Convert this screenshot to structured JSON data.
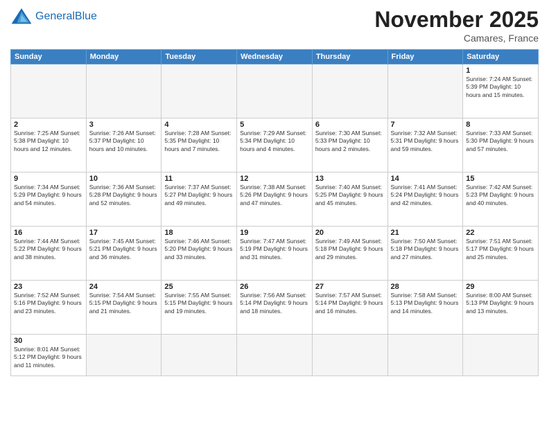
{
  "header": {
    "logo_general": "General",
    "logo_blue": "Blue",
    "month_title": "November 2025",
    "location": "Camares, France"
  },
  "days_of_week": [
    "Sunday",
    "Monday",
    "Tuesday",
    "Wednesday",
    "Thursday",
    "Friday",
    "Saturday"
  ],
  "weeks": [
    [
      {
        "day": null,
        "info": null
      },
      {
        "day": null,
        "info": null
      },
      {
        "day": null,
        "info": null
      },
      {
        "day": null,
        "info": null
      },
      {
        "day": null,
        "info": null
      },
      {
        "day": null,
        "info": null
      },
      {
        "day": "1",
        "info": "Sunrise: 7:24 AM\nSunset: 5:39 PM\nDaylight: 10 hours\nand 15 minutes."
      }
    ],
    [
      {
        "day": "2",
        "info": "Sunrise: 7:25 AM\nSunset: 5:38 PM\nDaylight: 10 hours\nand 12 minutes."
      },
      {
        "day": "3",
        "info": "Sunrise: 7:26 AM\nSunset: 5:37 PM\nDaylight: 10 hours\nand 10 minutes."
      },
      {
        "day": "4",
        "info": "Sunrise: 7:28 AM\nSunset: 5:35 PM\nDaylight: 10 hours\nand 7 minutes."
      },
      {
        "day": "5",
        "info": "Sunrise: 7:29 AM\nSunset: 5:34 PM\nDaylight: 10 hours\nand 4 minutes."
      },
      {
        "day": "6",
        "info": "Sunrise: 7:30 AM\nSunset: 5:33 PM\nDaylight: 10 hours\nand 2 minutes."
      },
      {
        "day": "7",
        "info": "Sunrise: 7:32 AM\nSunset: 5:31 PM\nDaylight: 9 hours\nand 59 minutes."
      },
      {
        "day": "8",
        "info": "Sunrise: 7:33 AM\nSunset: 5:30 PM\nDaylight: 9 hours\nand 57 minutes."
      }
    ],
    [
      {
        "day": "9",
        "info": "Sunrise: 7:34 AM\nSunset: 5:29 PM\nDaylight: 9 hours\nand 54 minutes."
      },
      {
        "day": "10",
        "info": "Sunrise: 7:36 AM\nSunset: 5:28 PM\nDaylight: 9 hours\nand 52 minutes."
      },
      {
        "day": "11",
        "info": "Sunrise: 7:37 AM\nSunset: 5:27 PM\nDaylight: 9 hours\nand 49 minutes."
      },
      {
        "day": "12",
        "info": "Sunrise: 7:38 AM\nSunset: 5:26 PM\nDaylight: 9 hours\nand 47 minutes."
      },
      {
        "day": "13",
        "info": "Sunrise: 7:40 AM\nSunset: 5:25 PM\nDaylight: 9 hours\nand 45 minutes."
      },
      {
        "day": "14",
        "info": "Sunrise: 7:41 AM\nSunset: 5:24 PM\nDaylight: 9 hours\nand 42 minutes."
      },
      {
        "day": "15",
        "info": "Sunrise: 7:42 AM\nSunset: 5:23 PM\nDaylight: 9 hours\nand 40 minutes."
      }
    ],
    [
      {
        "day": "16",
        "info": "Sunrise: 7:44 AM\nSunset: 5:22 PM\nDaylight: 9 hours\nand 38 minutes."
      },
      {
        "day": "17",
        "info": "Sunrise: 7:45 AM\nSunset: 5:21 PM\nDaylight: 9 hours\nand 36 minutes."
      },
      {
        "day": "18",
        "info": "Sunrise: 7:46 AM\nSunset: 5:20 PM\nDaylight: 9 hours\nand 33 minutes."
      },
      {
        "day": "19",
        "info": "Sunrise: 7:47 AM\nSunset: 5:19 PM\nDaylight: 9 hours\nand 31 minutes."
      },
      {
        "day": "20",
        "info": "Sunrise: 7:49 AM\nSunset: 5:18 PM\nDaylight: 9 hours\nand 29 minutes."
      },
      {
        "day": "21",
        "info": "Sunrise: 7:50 AM\nSunset: 5:18 PM\nDaylight: 9 hours\nand 27 minutes."
      },
      {
        "day": "22",
        "info": "Sunrise: 7:51 AM\nSunset: 5:17 PM\nDaylight: 9 hours\nand 25 minutes."
      }
    ],
    [
      {
        "day": "23",
        "info": "Sunrise: 7:52 AM\nSunset: 5:16 PM\nDaylight: 9 hours\nand 23 minutes."
      },
      {
        "day": "24",
        "info": "Sunrise: 7:54 AM\nSunset: 5:15 PM\nDaylight: 9 hours\nand 21 minutes."
      },
      {
        "day": "25",
        "info": "Sunrise: 7:55 AM\nSunset: 5:15 PM\nDaylight: 9 hours\nand 19 minutes."
      },
      {
        "day": "26",
        "info": "Sunrise: 7:56 AM\nSunset: 5:14 PM\nDaylight: 9 hours\nand 18 minutes."
      },
      {
        "day": "27",
        "info": "Sunrise: 7:57 AM\nSunset: 5:14 PM\nDaylight: 9 hours\nand 16 minutes."
      },
      {
        "day": "28",
        "info": "Sunrise: 7:58 AM\nSunset: 5:13 PM\nDaylight: 9 hours\nand 14 minutes."
      },
      {
        "day": "29",
        "info": "Sunrise: 8:00 AM\nSunset: 5:13 PM\nDaylight: 9 hours\nand 13 minutes."
      }
    ],
    [
      {
        "day": "30",
        "info": "Sunrise: 8:01 AM\nSunset: 5:12 PM\nDaylight: 9 hours\nand 11 minutes."
      },
      {
        "day": null,
        "info": null
      },
      {
        "day": null,
        "info": null
      },
      {
        "day": null,
        "info": null
      },
      {
        "day": null,
        "info": null
      },
      {
        "day": null,
        "info": null
      },
      {
        "day": null,
        "info": null
      }
    ]
  ]
}
